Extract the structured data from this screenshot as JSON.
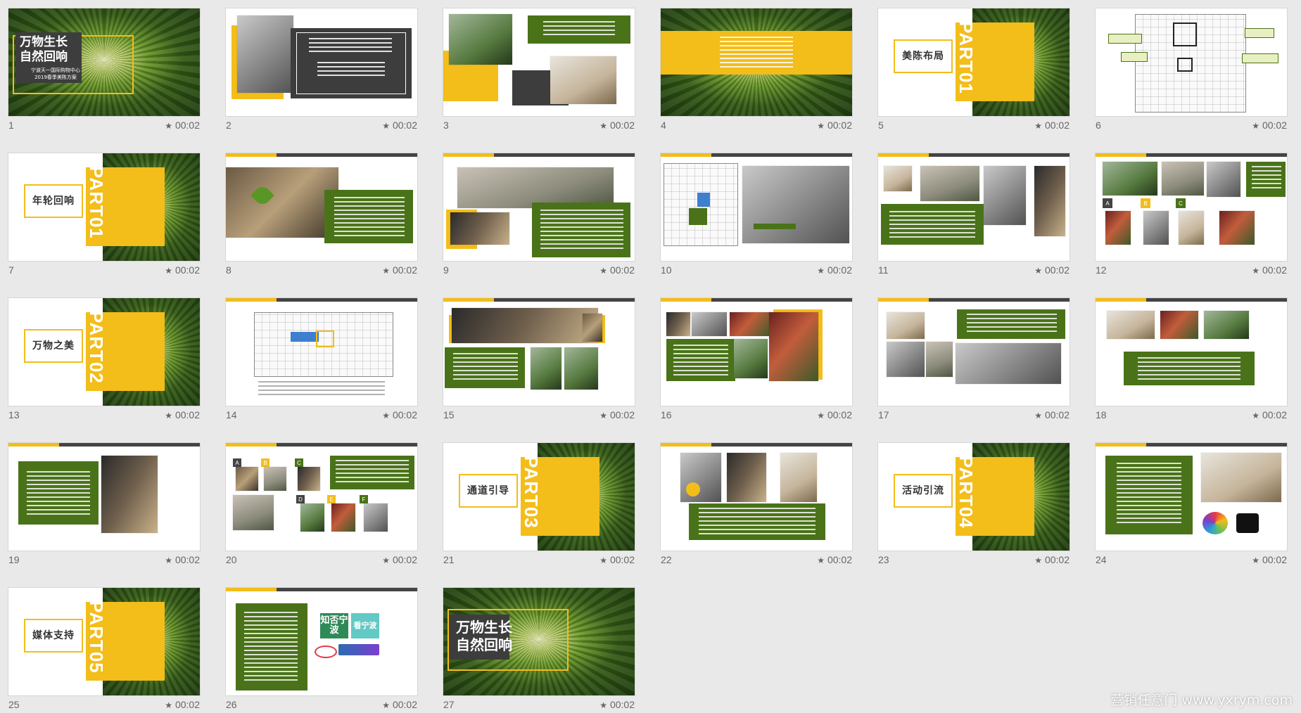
{
  "slides": [
    {
      "number": "1",
      "duration": "00:02",
      "title_lines": [
        "万物生长",
        "自然回响"
      ],
      "sub_lines": [
        "宁波天一国际购物中心",
        "2019春季美陈方案"
      ]
    },
    {
      "number": "2",
      "duration": "00:02"
    },
    {
      "number": "3",
      "duration": "00:02"
    },
    {
      "number": "4",
      "duration": "00:02"
    },
    {
      "number": "5",
      "duration": "00:02",
      "section_title": "美陈布局",
      "part": "PART01"
    },
    {
      "number": "6",
      "duration": "00:02"
    },
    {
      "number": "7",
      "duration": "00:02",
      "section_title": "年轮回响",
      "part": "PART01"
    },
    {
      "number": "8",
      "duration": "00:02"
    },
    {
      "number": "9",
      "duration": "00:02"
    },
    {
      "number": "10",
      "duration": "00:02"
    },
    {
      "number": "11",
      "duration": "00:02"
    },
    {
      "number": "12",
      "duration": "00:02",
      "badges": [
        "A",
        "B",
        "C"
      ]
    },
    {
      "number": "13",
      "duration": "00:02",
      "section_title": "万物之美",
      "part": "PART02"
    },
    {
      "number": "14",
      "duration": "00:02"
    },
    {
      "number": "15",
      "duration": "00:02"
    },
    {
      "number": "16",
      "duration": "00:02"
    },
    {
      "number": "17",
      "duration": "00:02"
    },
    {
      "number": "18",
      "duration": "00:02"
    },
    {
      "number": "19",
      "duration": "00:02"
    },
    {
      "number": "20",
      "duration": "00:02",
      "badges": [
        "A",
        "B",
        "C",
        "D",
        "E",
        "F"
      ]
    },
    {
      "number": "21",
      "duration": "00:02",
      "section_title": "通道引导",
      "part": "PART03"
    },
    {
      "number": "22",
      "duration": "00:02"
    },
    {
      "number": "23",
      "duration": "00:02",
      "section_title": "活动引流",
      "part": "PART04"
    },
    {
      "number": "24",
      "duration": "00:02"
    },
    {
      "number": "25",
      "duration": "00:02",
      "section_title": "媒体支持",
      "part": "PART05"
    },
    {
      "number": "26",
      "duration": "00:02",
      "logos": [
        "知否宁波",
        "看宁波"
      ]
    },
    {
      "number": "27",
      "duration": "00:02",
      "title_lines": [
        "万物生长",
        "自然回响"
      ]
    }
  ],
  "watermark": "营销任意门 www.yxrym.com",
  "colors": {
    "accent": "#f3bd1a",
    "green": "#4a7319",
    "background": "#e9e9e9",
    "dark": "#3d3d3d"
  },
  "icons": {
    "duration": "star-icon"
  }
}
